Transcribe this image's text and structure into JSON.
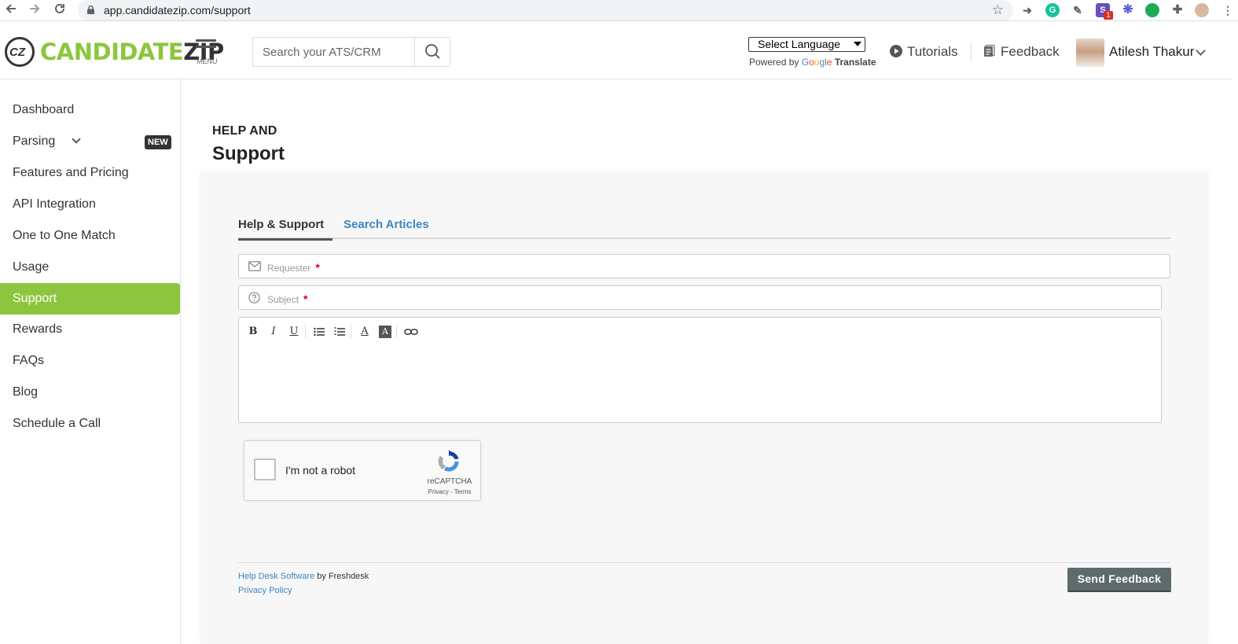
{
  "browser": {
    "url": "app.candidatezip.com/support",
    "icons": [
      "back-arrow-icon",
      "forward-arrow-icon",
      "reload-icon",
      "lock-icon",
      "bookmark-star-icon",
      "extensions-puzzle-icon",
      "kebab-menu-icon"
    ],
    "ext_badge": "1"
  },
  "header": {
    "logo_mark": "CZ",
    "logo_candidate": "CANDIDATE",
    "logo_zip": "ZIP",
    "menu_label": "MENU",
    "search_placeholder": "Search your ATS/CRM",
    "language_select": "Select Language",
    "powered_by": "Powered by",
    "google": [
      "G",
      "o",
      "o",
      "g",
      "l",
      "e"
    ],
    "translate": "Translate",
    "tutorials": "Tutorials",
    "feedback": "Feedback",
    "user_name": "Atilesh Thakur",
    "brand_color": "#8cc63f"
  },
  "sidebar": {
    "items": [
      {
        "label": "Dashboard"
      },
      {
        "label": "Parsing",
        "badge": "NEW"
      },
      {
        "label": "Features and Pricing"
      },
      {
        "label": "API Integration"
      },
      {
        "label": "One to One Match"
      },
      {
        "label": "Usage"
      },
      {
        "label": "Support",
        "active": true
      },
      {
        "label": "Rewards"
      },
      {
        "label": "FAQs"
      },
      {
        "label": "Blog"
      },
      {
        "label": "Schedule a Call"
      }
    ]
  },
  "main": {
    "pre_title": "HELP AND",
    "title": "Support",
    "tabs": [
      {
        "label": "Help & Support",
        "active": true
      },
      {
        "label": "Search Articles"
      }
    ],
    "requester_placeholder": "Requester",
    "subject_placeholder": "Subject",
    "required_mark": "*",
    "toolbar": {
      "bold": "B",
      "italic": "I",
      "underline": "U",
      "font_color": "A",
      "bg_color": "A"
    },
    "recaptcha": {
      "label": "I'm not a robot",
      "brand": "reCAPTCHA",
      "privacy": "Privacy",
      "separator": " - ",
      "terms": "Terms"
    },
    "footer": {
      "help_desk_link": "Help Desk Software",
      "by_text": " by Freshdesk",
      "privacy_link": "Privacy Policy"
    },
    "send_button": "Send Feedback",
    "link_color": "#3b86c4"
  }
}
